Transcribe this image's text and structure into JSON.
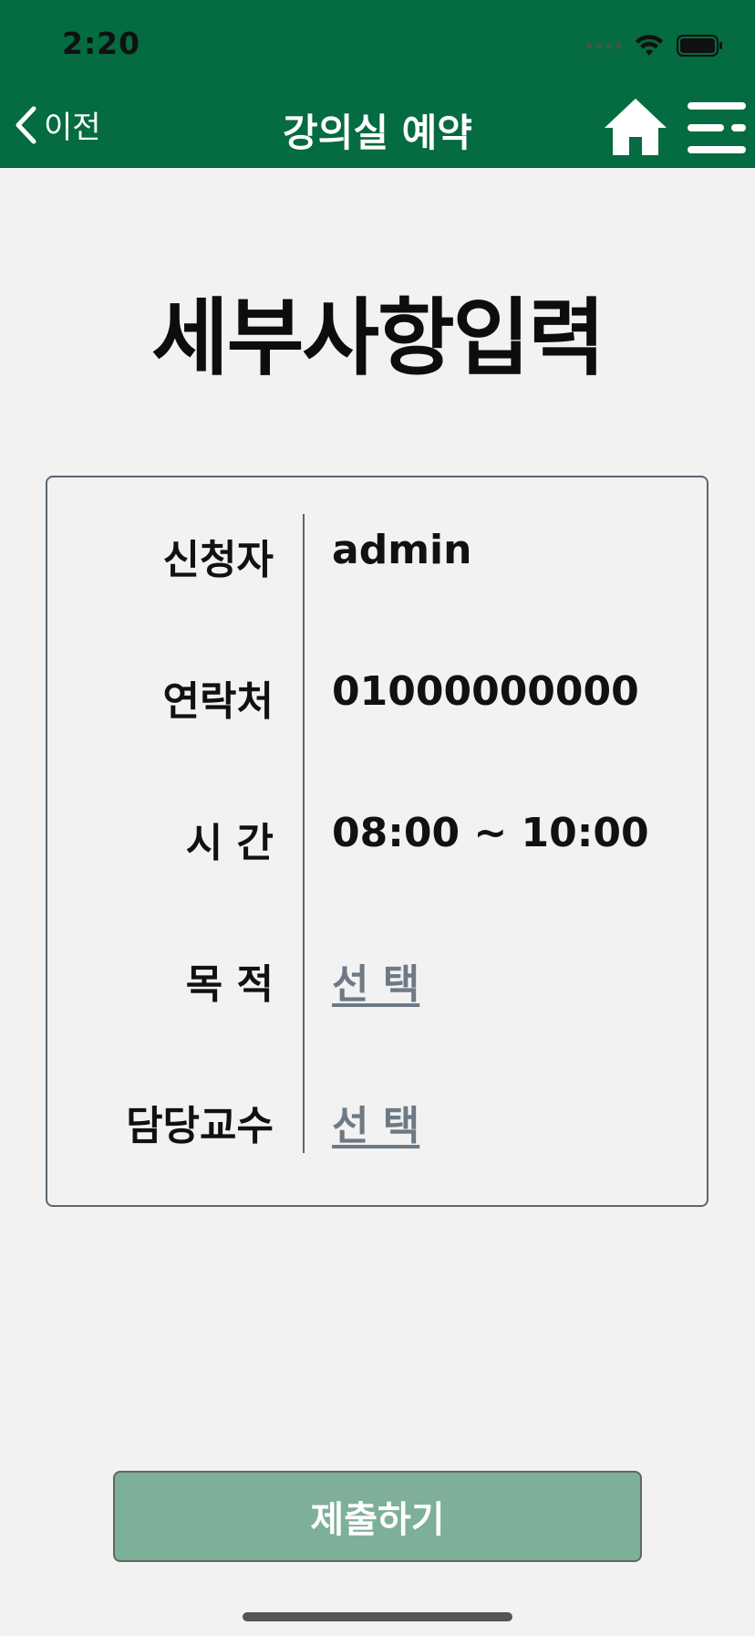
{
  "status_bar": {
    "time": "2:20"
  },
  "nav": {
    "back_label": "이전",
    "title": "강의실 예약",
    "home_icon": "home-icon",
    "menu_icon": "menu-icon"
  },
  "page": {
    "title": "세부사항입력"
  },
  "form": {
    "rows": [
      {
        "label": "신청자",
        "value": "admin",
        "type": "text"
      },
      {
        "label": "연락처",
        "value": "01000000000",
        "type": "text"
      },
      {
        "label": "시 간",
        "value": "08:00 ~ 10:00",
        "type": "text"
      },
      {
        "label": "목 적",
        "value": "선 택",
        "type": "link"
      },
      {
        "label": "담당교수",
        "value": "선 택",
        "type": "link"
      }
    ]
  },
  "submit": {
    "label": "제출하기"
  },
  "colors": {
    "header_bg": "#056b40",
    "page_bg": "#f2f2f2",
    "submit_bg": "#7daf99",
    "link": "#6d7a85"
  }
}
